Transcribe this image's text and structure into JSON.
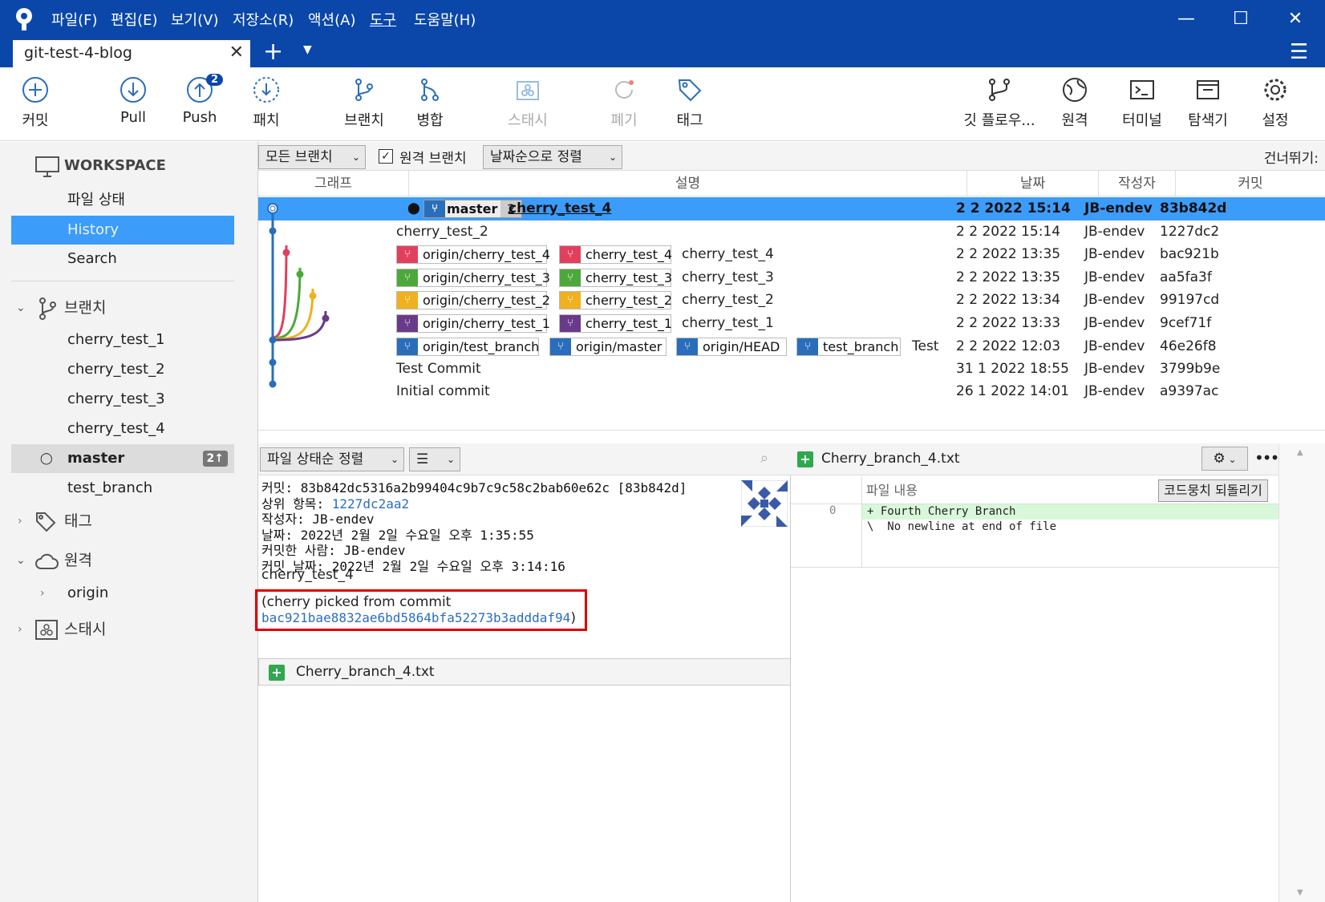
{
  "app": {
    "menu": [
      "파일(F)",
      "편집(E)",
      "보기(V)",
      "저장소(R)",
      "액션(A)",
      "도구",
      "도움말(H)"
    ],
    "tab_title": "git-test-4-blog"
  },
  "toolbar": {
    "commit": "커밋",
    "pull": "Pull",
    "push": "Push",
    "push_badge": "2",
    "patch": "패치",
    "branch": "브랜치",
    "merge": "병합",
    "stash": "스태시",
    "discard": "폐기",
    "tag": "태그",
    "gitflow": "깃 플로우...",
    "remote": "원격",
    "terminal": "터미널",
    "explorer": "탐색기",
    "settings": "설정"
  },
  "sidebar": {
    "workspace": "WORKSPACE",
    "file_status": "파일 상태",
    "history": "History",
    "search": "Search",
    "branches_header": "브랜치",
    "branches": [
      "cherry_test_1",
      "cherry_test_2",
      "cherry_test_3",
      "cherry_test_4",
      "master",
      "test_branch"
    ],
    "master_badge": "2↑",
    "tags_header": "태그",
    "remotes_header": "원격",
    "remote_origin": "origin",
    "stash_header": "스태시"
  },
  "filter": {
    "branches": "모든 브랜치",
    "remote_branches": "원격 브랜치",
    "sort": "날짜순으로 정렬",
    "jump": "건너뛰기:"
  },
  "columns": {
    "graph": "그래프",
    "desc": "설명",
    "date": "날짜",
    "author": "작성자",
    "commit": "커밋"
  },
  "commits": [
    {
      "desc": "cherry_test_4",
      "date": "2 2 2022 15:14",
      "author": "JB-endev",
      "hash": "83b842d"
    },
    {
      "desc": "cherry_test_2",
      "date": "2 2 2022 15:14",
      "author": "JB-endev",
      "hash": "1227dc2"
    },
    {
      "desc": "cherry_test_4",
      "date": "2 2 2022 13:35",
      "author": "JB-endev",
      "hash": "bac921b"
    },
    {
      "desc": "cherry_test_3",
      "date": "2 2 2022 13:35",
      "author": "JB-endev",
      "hash": "aa5fa3f"
    },
    {
      "desc": "cherry_test_2",
      "date": "2 2 2022 13:34",
      "author": "JB-endev",
      "hash": "99197cd"
    },
    {
      "desc": "cherry_test_1",
      "date": "2 2 2022 13:33",
      "author": "JB-endev",
      "hash": "9cef71f"
    },
    {
      "desc": "Test",
      "date": "2 2 2022 12:03",
      "author": "JB-endev",
      "hash": "46e26f8"
    },
    {
      "desc": "Test Commit",
      "date": "31 1 2022 18:55",
      "author": "JB-endev",
      "hash": "3799b9e"
    },
    {
      "desc": "Initial commit",
      "date": "26 1 2022 14:01",
      "author": "JB-endev",
      "hash": "a9397ac"
    }
  ],
  "refs": {
    "master": "master",
    "master_count": "2",
    "origin_cherry_test_4": "origin/cherry_test_4",
    "cherry_test_4": "cherry_test_4",
    "origin_cherry_test_3": "origin/cherry_test_3",
    "cherry_test_3": "cherry_test_3",
    "origin_cherry_test_2": "origin/cherry_test_2",
    "cherry_test_2": "cherry_test_2",
    "origin_cherry_test_1": "origin/cherry_test_1",
    "cherry_test_1": "cherry_test_1",
    "origin_test_branch": "origin/test_branch",
    "origin_master": "origin/master",
    "origin_head": "origin/HEAD",
    "test_branch": "test_branch"
  },
  "colors": {
    "cherry_test_4": "#e0405e",
    "cherry_test_3": "#4ca83a",
    "cherry_test_2": "#f0b020",
    "cherry_test_1": "#6a3a8a",
    "main": "#2a6ebb"
  },
  "details": {
    "sort_label": "파일 상태순 정렬",
    "commit_line": "커밋: 83b842dc5316a2b99404c9b7c9c58c2bab60e62c [83b842d]",
    "parent_label": "상위 항목: ",
    "parent_hash": "1227dc2aa2",
    "author_line": "작성자: JB-endev",
    "date_line": "날짜: 2022년 2월 2일 수요일 오후 1:35:55",
    "committer_line": "커밋한 사람: JB-endev",
    "commit_date_line": "커밋 날짜: 2022년 2월 2일 수요일 오후 3:14:16",
    "message": "cherry_test_4",
    "cherry_line1": "(cherry picked from commit",
    "cherry_hash": "bac921bae8832ae6bd5864bfa52273b3adddaf94",
    "cherry_close": ")",
    "file": "Cherry_branch_4.txt"
  },
  "diff": {
    "file": "Cherry_branch_4.txt",
    "header": "파일 내용",
    "revert": "코드뭉치 되돌리기",
    "line_no": "0",
    "line1": "+ Fourth Cherry Branch",
    "line2": "\\  No newline at end of file"
  }
}
